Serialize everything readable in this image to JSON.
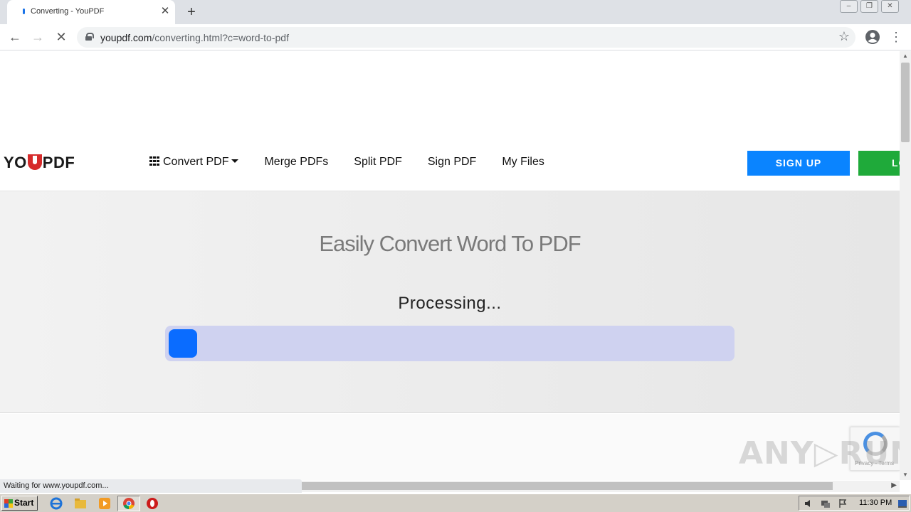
{
  "browser": {
    "tab_title": "Converting - YouPDF",
    "url_host": "youpdf.com",
    "url_path": "/converting.html?c=word-to-pdf",
    "status_text": "Waiting for www.youpdf.com..."
  },
  "site": {
    "logo_left": "YO",
    "logo_right": "PDF",
    "nav": {
      "convert": "Convert PDF",
      "merge": "Merge PDFs",
      "split": "Split PDF",
      "sign": "Sign PDF",
      "files": "My Files"
    },
    "signup_label": "SIGN UP",
    "login_label": "LO",
    "brand_colors": {
      "signup": "#0a84ff",
      "login": "#1faa3a",
      "progress_fill": "#0a6cff",
      "progress_track": "#cfd2f0"
    }
  },
  "hero": {
    "title": "Easily Convert Word To PDF",
    "processing": "Processing...",
    "progress_fraction": 0.05
  },
  "recaptcha": {
    "terms": "Privacy - Terms"
  },
  "watermark": "ANY▷RUN",
  "taskbar": {
    "start_label": "Start",
    "clock": "11:30 PM",
    "icons": [
      "ie-icon",
      "explorer-icon",
      "media-player-icon",
      "chrome-icon",
      "opera-icon"
    ]
  }
}
